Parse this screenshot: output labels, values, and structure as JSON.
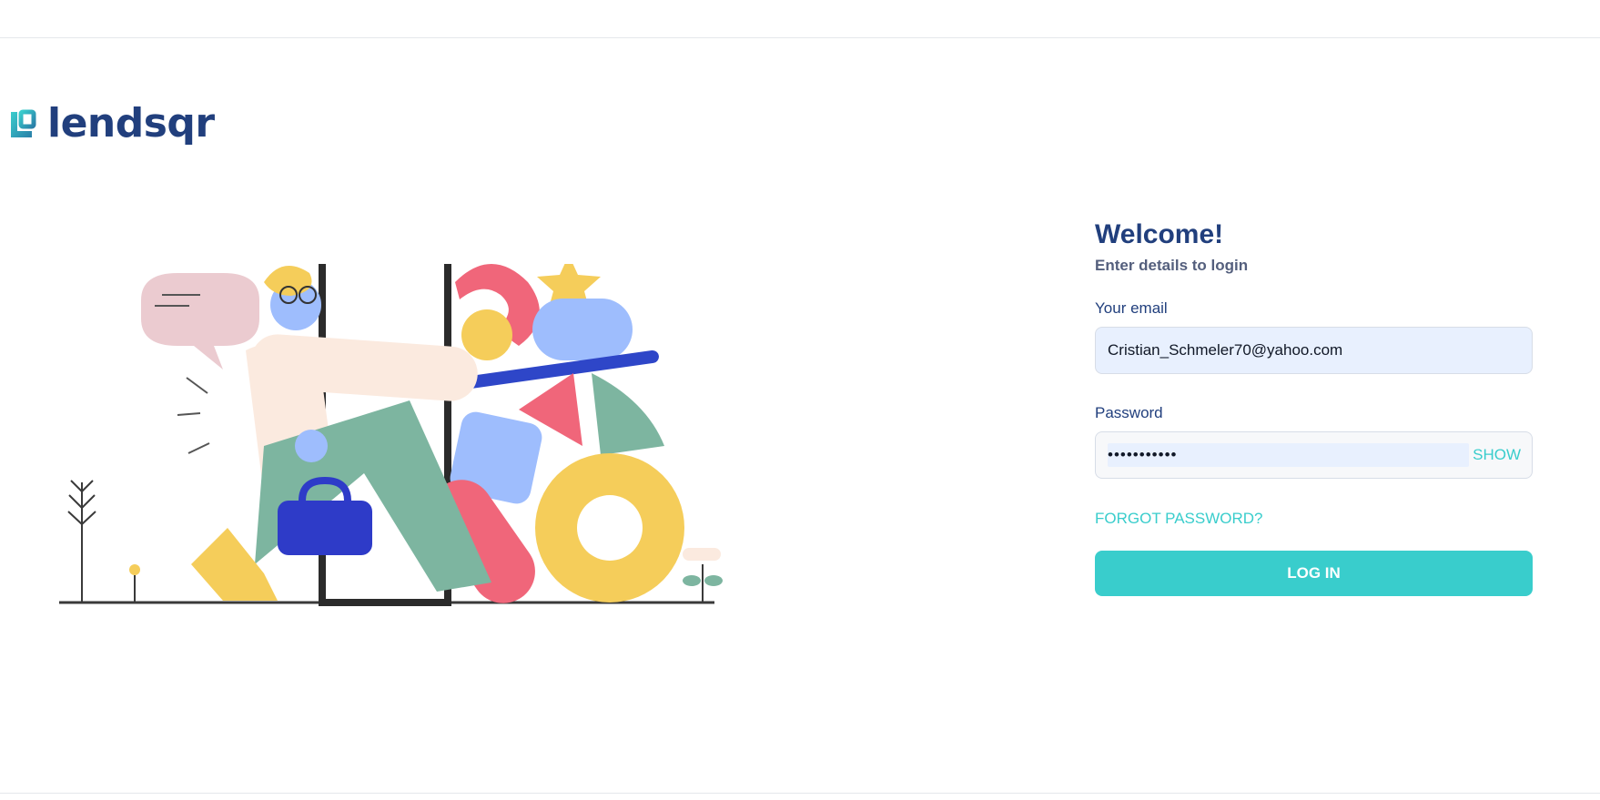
{
  "brand": {
    "name": "lendsqr",
    "logo_icon": "lendsqr-logo-mark",
    "color": "#213f7d"
  },
  "illustration": {
    "icon": "person-walking-through-door-illustration"
  },
  "login": {
    "title": "Welcome!",
    "subtitle": "Enter details to login",
    "email_label": "Your email",
    "email_value": "Cristian_Schmeler70@yahoo.com",
    "password_label": "Password",
    "password_value": "•••••••••••",
    "show_label": "SHOW",
    "forgot_label": "FORGOT PASSWORD?",
    "submit_label": "LOG IN"
  },
  "colors": {
    "accent": "#39cdcc",
    "heading": "#213f7d",
    "subtext": "#545f7d",
    "autofill": "#e8f0fe"
  }
}
